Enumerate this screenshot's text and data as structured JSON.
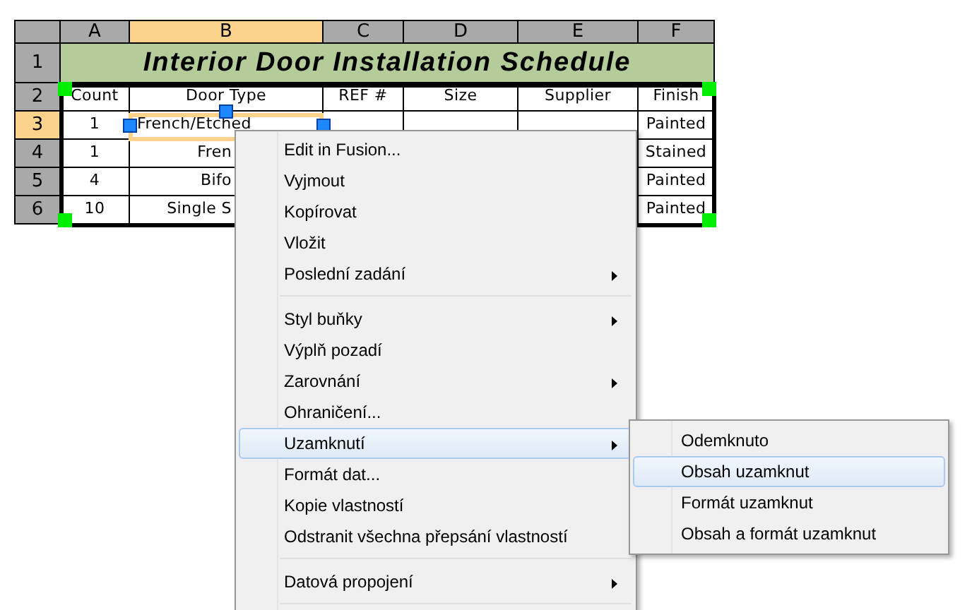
{
  "sheet": {
    "columns": [
      {
        "label": "A",
        "selected": false
      },
      {
        "label": "B",
        "selected": true
      },
      {
        "label": "C",
        "selected": false
      },
      {
        "label": "D",
        "selected": false
      },
      {
        "label": "E",
        "selected": false
      },
      {
        "label": "F",
        "selected": false
      }
    ],
    "rows": [
      {
        "header": "1",
        "selected": false,
        "kind": "title",
        "title": "Interior Door Installation Schedule"
      },
      {
        "header": "2",
        "selected": false,
        "kind": "cells",
        "cells": [
          "Count",
          "Door Type",
          "REF #",
          "Size",
          "Supplier",
          "Finish"
        ]
      },
      {
        "header": "3",
        "selected": true,
        "kind": "cells",
        "cells": [
          "1",
          "French/Etched",
          null,
          null,
          null,
          "Painted"
        ]
      },
      {
        "header": "4",
        "selected": false,
        "kind": "cells",
        "cells": [
          "1",
          "Fren",
          null,
          null,
          null,
          "Stained"
        ]
      },
      {
        "header": "5",
        "selected": false,
        "kind": "cells",
        "cells": [
          "4",
          "Bifo",
          null,
          null,
          null,
          "Painted"
        ]
      },
      {
        "header": "6",
        "selected": false,
        "kind": "cells",
        "cells": [
          "10",
          "Single S",
          null,
          null,
          null,
          "Painted"
        ]
      }
    ]
  },
  "context_menu": {
    "items": [
      {
        "kind": "item",
        "label": "Edit in Fusion...",
        "submenu": false,
        "selected": false
      },
      {
        "kind": "item",
        "label": "Vyjmout",
        "submenu": false,
        "selected": false
      },
      {
        "kind": "item",
        "label": "Kopírovat",
        "submenu": false,
        "selected": false
      },
      {
        "kind": "item",
        "label": "Vložit",
        "submenu": false,
        "selected": false
      },
      {
        "kind": "item",
        "label": "Poslední zadání",
        "submenu": true,
        "selected": false
      },
      {
        "kind": "separator"
      },
      {
        "kind": "item",
        "label": "Styl buňky",
        "submenu": true,
        "selected": false
      },
      {
        "kind": "item",
        "label": "Výplň pozadí",
        "submenu": false,
        "selected": false
      },
      {
        "kind": "item",
        "label": "Zarovnání",
        "submenu": true,
        "selected": false
      },
      {
        "kind": "item",
        "label": "Ohraničení...",
        "submenu": false,
        "selected": false
      },
      {
        "kind": "item",
        "label": "Uzamknutí",
        "submenu": true,
        "selected": true
      },
      {
        "kind": "item",
        "label": "Formát dat...",
        "submenu": false,
        "selected": false
      },
      {
        "kind": "item",
        "label": "Kopie vlastností",
        "submenu": false,
        "selected": false
      },
      {
        "kind": "item",
        "label": "Odstranit všechna přepsání vlastností",
        "submenu": false,
        "selected": false
      },
      {
        "kind": "separator"
      },
      {
        "kind": "item",
        "label": "Datová propojení",
        "submenu": true,
        "selected": false
      },
      {
        "kind": "separator"
      }
    ]
  },
  "submenu": {
    "items": [
      {
        "label": "Odemknuto",
        "selected": false
      },
      {
        "label": "Obsah uzamknut",
        "selected": true
      },
      {
        "label": "Formát uzamknut",
        "selected": false
      },
      {
        "label": "Obsah a formát uzamknut",
        "selected": false
      }
    ]
  }
}
